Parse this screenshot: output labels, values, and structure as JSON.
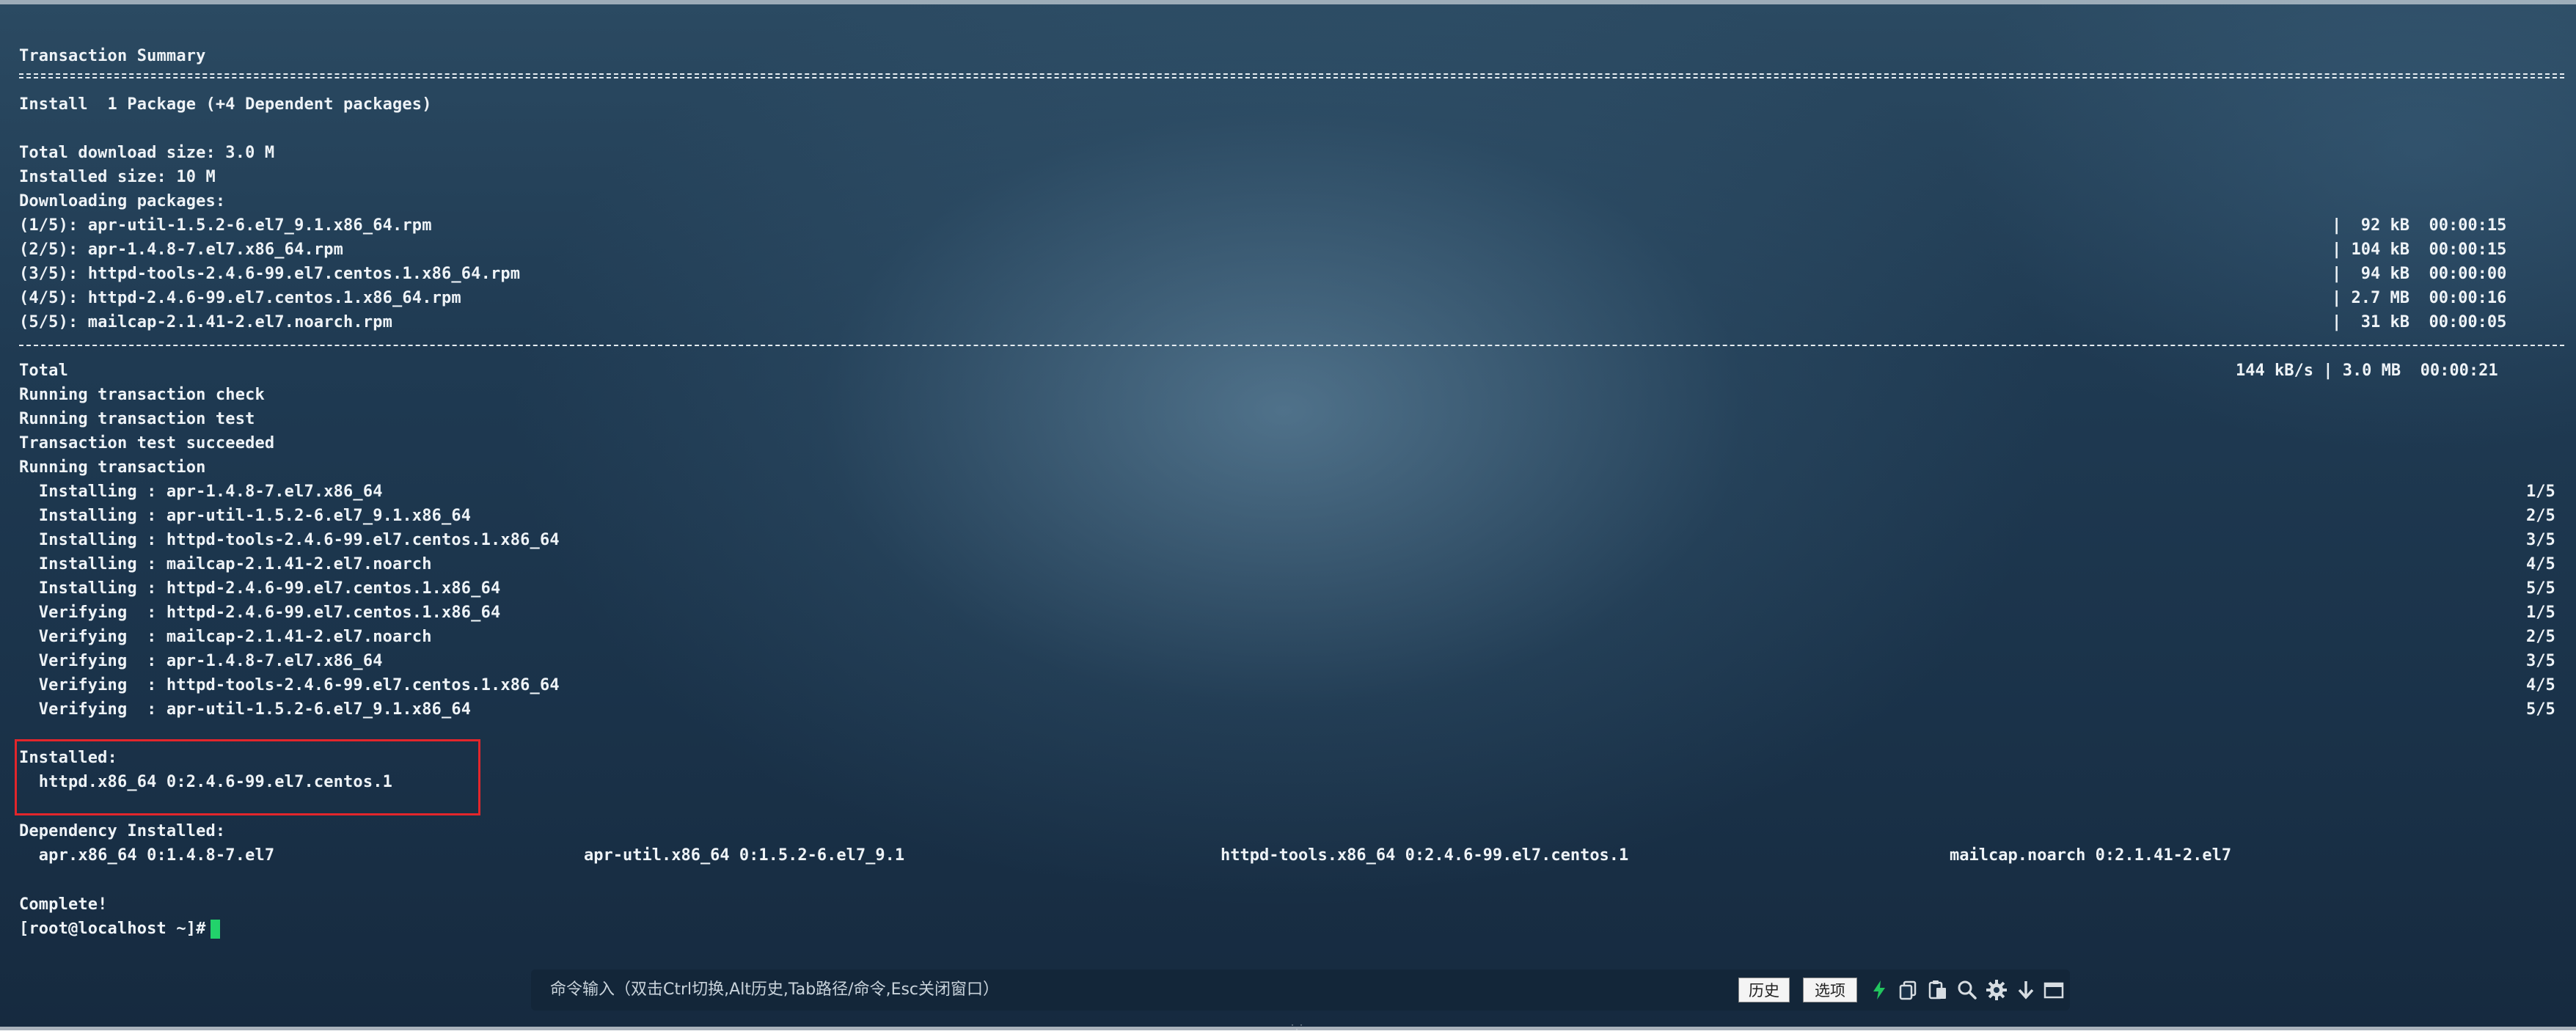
{
  "terminal": {
    "transaction_summary": "Transaction Summary",
    "install_line": "Install  1 Package (+4 Dependent packages)",
    "total_download": "Total download size: 3.0 M",
    "installed_size": "Installed size: 10 M",
    "downloading": "Downloading packages:",
    "downloads": [
      {
        "name": "(1/5): apr-util-1.5.2-6.el7_9.1.x86_64.rpm",
        "stats": "|  92 kB  00:00:15"
      },
      {
        "name": "(2/5): apr-1.4.8-7.el7.x86_64.rpm",
        "stats": "| 104 kB  00:00:15"
      },
      {
        "name": "(3/5): httpd-tools-2.4.6-99.el7.centos.1.x86_64.rpm",
        "stats": "|  94 kB  00:00:00"
      },
      {
        "name": "(4/5): httpd-2.4.6-99.el7.centos.1.x86_64.rpm",
        "stats": "| 2.7 MB  00:00:16"
      },
      {
        "name": "(5/5): mailcap-2.1.41-2.el7.noarch.rpm",
        "stats": "|  31 kB  00:00:05"
      }
    ],
    "total_label": "Total",
    "total_stats": "144 kB/s | 3.0 MB  00:00:21",
    "check": "Running transaction check",
    "test": "Running transaction test",
    "test_ok": "Transaction test succeeded",
    "running": "Running transaction",
    "steps": [
      {
        "text": "  Installing : apr-1.4.8-7.el7.x86_64",
        "count": "1/5"
      },
      {
        "text": "  Installing : apr-util-1.5.2-6.el7_9.1.x86_64",
        "count": "2/5"
      },
      {
        "text": "  Installing : httpd-tools-2.4.6-99.el7.centos.1.x86_64",
        "count": "3/5"
      },
      {
        "text": "  Installing : mailcap-2.1.41-2.el7.noarch",
        "count": "4/5"
      },
      {
        "text": "  Installing : httpd-2.4.6-99.el7.centos.1.x86_64",
        "count": "5/5"
      },
      {
        "text": "  Verifying  : httpd-2.4.6-99.el7.centos.1.x86_64",
        "count": "1/5"
      },
      {
        "text": "  Verifying  : mailcap-2.1.41-2.el7.noarch",
        "count": "2/5"
      },
      {
        "text": "  Verifying  : apr-1.4.8-7.el7.x86_64",
        "count": "3/5"
      },
      {
        "text": "  Verifying  : httpd-tools-2.4.6-99.el7.centos.1.x86_64",
        "count": "4/5"
      },
      {
        "text": "  Verifying  : apr-util-1.5.2-6.el7_9.1.x86_64",
        "count": "5/5"
      }
    ],
    "installed_label": "Installed:",
    "installed_pkg": "  httpd.x86_64 0:2.4.6-99.el7.centos.1",
    "dep_label": "Dependency Installed:",
    "deps": [
      "  apr.x86_64 0:1.4.8-7.el7",
      "apr-util.x86_64 0:1.5.2-6.el7_9.1",
      "httpd-tools.x86_64 0:2.4.6-99.el7.centos.1",
      "mailcap.noarch 0:2.1.41-2.el7"
    ],
    "complete": "Complete!",
    "prompt": "[root@localhost ~]#"
  },
  "command_bar": {
    "placeholder": "命令输入（双击Ctrl切换,Alt历史,Tab路径/命令,Esc关闭窗口）",
    "history_button": "历史",
    "options_button": "选项"
  },
  "colors": {
    "highlight_border": "#e3262b",
    "cursor": "#22d36b",
    "lightning": "#22c55e"
  }
}
